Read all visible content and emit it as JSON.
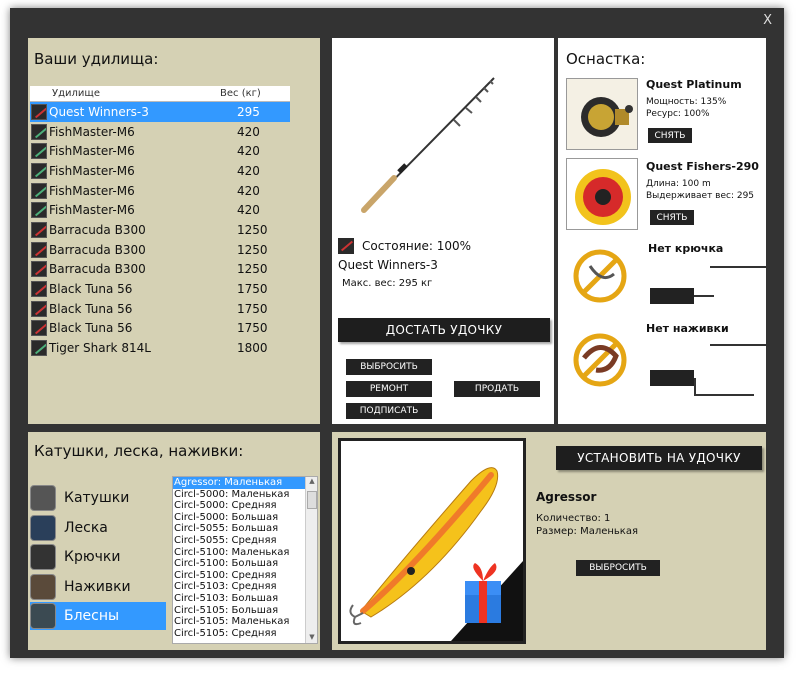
{
  "window": {
    "close_label": "X"
  },
  "rods": {
    "title": "Ваши удилища:",
    "col_name": "Удилище",
    "col_weight": "Вес (кг)",
    "items": [
      {
        "name": "Quest Winners-3",
        "weight": "295",
        "icon": "rod-red-icon"
      },
      {
        "name": "FishMaster-M6",
        "weight": "420",
        "icon": "rod-green-icon"
      },
      {
        "name": "FishMaster-M6",
        "weight": "420",
        "icon": "rod-green-icon"
      },
      {
        "name": "FishMaster-M6",
        "weight": "420",
        "icon": "rod-green-icon"
      },
      {
        "name": "FishMaster-M6",
        "weight": "420",
        "icon": "rod-green-icon"
      },
      {
        "name": "FishMaster-M6",
        "weight": "420",
        "icon": "rod-green-icon"
      },
      {
        "name": "Barracuda B300",
        "weight": "1250",
        "icon": "rod-red-icon"
      },
      {
        "name": "Barracuda B300",
        "weight": "1250",
        "icon": "rod-red-icon"
      },
      {
        "name": "Barracuda B300",
        "weight": "1250",
        "icon": "rod-red-icon"
      },
      {
        "name": "Black Tuna 56",
        "weight": "1750",
        "icon": "rod-red-icon"
      },
      {
        "name": "Black Tuna 56",
        "weight": "1750",
        "icon": "rod-red-icon"
      },
      {
        "name": "Black Tuna 56",
        "weight": "1750",
        "icon": "rod-red-icon"
      },
      {
        "name": "Tiger Shark 814L",
        "weight": "1800",
        "icon": "rod-green-icon"
      }
    ]
  },
  "rod_detail": {
    "state": "Состояние: 100%",
    "name": "Quest Winners-3",
    "max_weight": "Макс. вес: 295 кг",
    "equip_button": "ДОСТАТЬ УДОЧКУ",
    "discard_button": "ВЫБРОСИТЬ",
    "repair_button": "РЕМОНТ",
    "sell_button": "ПРОДАТЬ",
    "sign_button": "ПОДПИСАТЬ"
  },
  "tackle": {
    "title": "Оснастка:",
    "reel": {
      "name": "Quest Platinum",
      "power": "Мощность: 135%",
      "resource": "Ресурс: 100%",
      "remove": "СНЯТЬ"
    },
    "line": {
      "name": "Quest Fishers-290",
      "length": "Длина: 100 m",
      "holds": "Выдерживает вес: 295",
      "remove": "СНЯТЬ"
    },
    "hook": {
      "name": "Нет крючка"
    },
    "bait": {
      "name": "Нет наживки"
    }
  },
  "categories": {
    "title": "Катушки, леска, наживки:",
    "items": [
      {
        "label": "Катушки",
        "icon": "reel-icon"
      },
      {
        "label": "Леска",
        "icon": "line-spool-icon"
      },
      {
        "label": "Крючки",
        "icon": "hook-icon"
      },
      {
        "label": "Наживки",
        "icon": "bait-icon"
      },
      {
        "label": "Блесны",
        "icon": "lure-icon"
      }
    ],
    "selected": 4,
    "list": [
      "Agressor: Маленькая",
      "Circl-5000: Маленькая",
      "Circl-5000: Средняя",
      "Circl-5000: Большая",
      "Circl-5055: Большая",
      "Circl-5055: Средняя",
      "Circl-5100: Маленькая",
      "Circl-5100: Большая",
      "Circl-5100: Средняя",
      "Circl-5103: Средняя",
      "Circl-5103: Большая",
      "Circl-5105: Большая",
      "Circl-5105: Маленькая",
      "Circl-5105: Средняя"
    ]
  },
  "lure": {
    "install_button": "УСТАНОВИТЬ НА УДОЧКУ",
    "name": "Agressor",
    "quantity": "Количество: 1",
    "size": "Размер: Маленькая",
    "discard_button": "ВЫБРОСИТЬ"
  },
  "colors": {
    "selection": "#3399ff",
    "panel": "#d5d1b4",
    "frame": "#333333",
    "button": "#1e1e1e"
  }
}
